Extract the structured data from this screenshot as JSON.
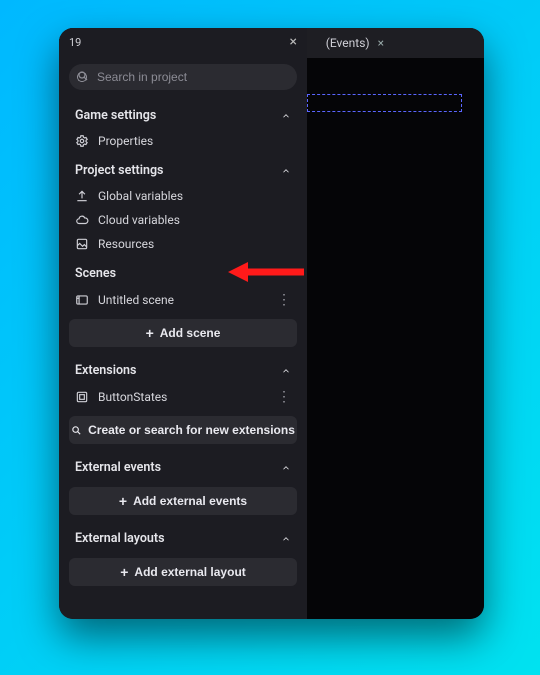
{
  "colors": {
    "accent": "#ff1a1a"
  },
  "panel": {
    "title": "19"
  },
  "tab": {
    "label": "(Events)"
  },
  "search": {
    "placeholder": "Search in project"
  },
  "sections": {
    "game": {
      "title": "Game settings",
      "items": [
        {
          "label": "Properties",
          "icon": "gear"
        }
      ]
    },
    "project": {
      "title": "Project settings",
      "items": [
        {
          "label": "Global variables",
          "icon": "upload"
        },
        {
          "label": "Cloud variables",
          "icon": "cloud"
        },
        {
          "label": "Resources",
          "icon": "resources"
        }
      ]
    },
    "scenes": {
      "title": "Scenes",
      "items": [
        {
          "label": "Untitled scene",
          "icon": "scene",
          "menu": true
        }
      ],
      "button": "Add scene"
    },
    "extensions": {
      "title": "Extensions",
      "items": [
        {
          "label": "ButtonStates",
          "icon": "extension",
          "menu": true
        }
      ],
      "button": "Create or search for new extensions"
    },
    "external_events": {
      "title": "External events",
      "button": "Add external events"
    },
    "external_layouts": {
      "title": "External layouts",
      "button": "Add external layout"
    }
  }
}
